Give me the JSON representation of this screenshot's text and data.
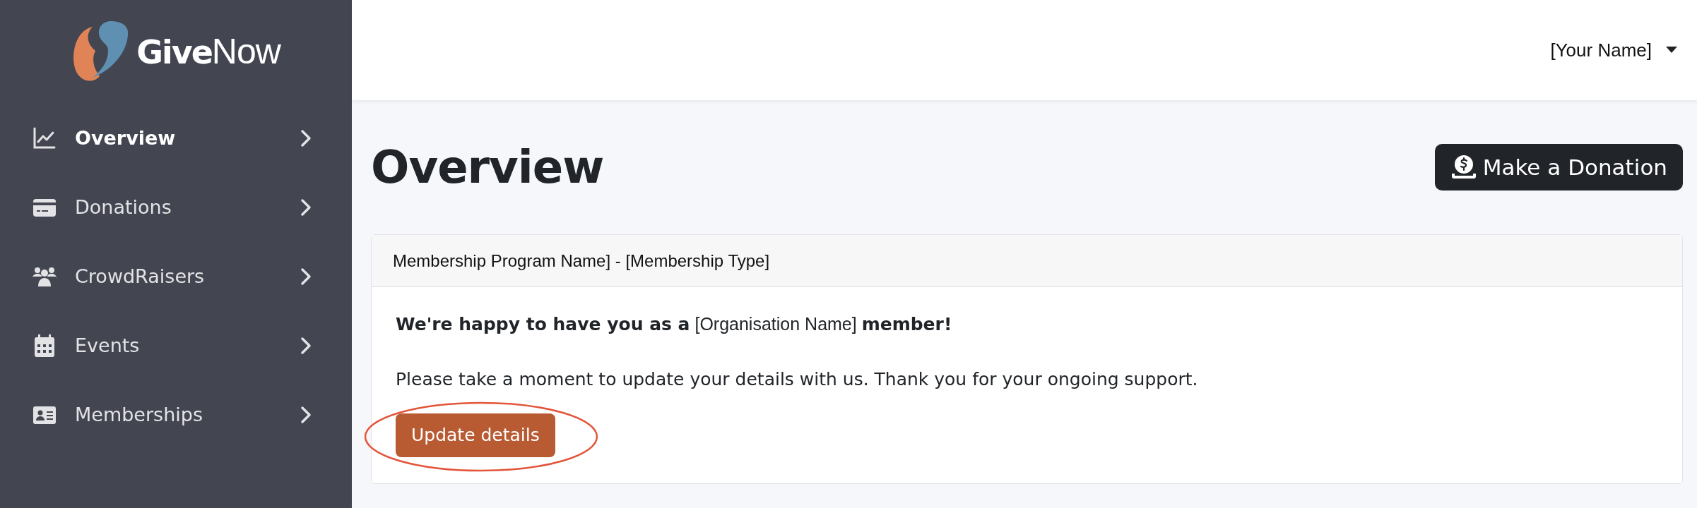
{
  "sidebar": {
    "logo": {
      "bold": "Give",
      "light": "Now"
    },
    "items": [
      {
        "label": "Overview",
        "selected": true
      },
      {
        "label": "Donations",
        "selected": false
      },
      {
        "label": "CrowdRaisers",
        "selected": false
      },
      {
        "label": "Events",
        "selected": false
      },
      {
        "label": "Memberships",
        "selected": false
      }
    ]
  },
  "header": {
    "user_menu": "[Your Name]"
  },
  "page": {
    "title": "Overview",
    "action_button": "Make a Donation"
  },
  "card": {
    "header": "Membership Program Name] - [Membership Type]",
    "greeting": "**We're happy to have you as a** [Organisation Name] **member!**",
    "message": "Please take a moment to update your details with us. Thank you for your ongoing support.",
    "button": "Update details",
    "button_highlighted": true
  }
}
